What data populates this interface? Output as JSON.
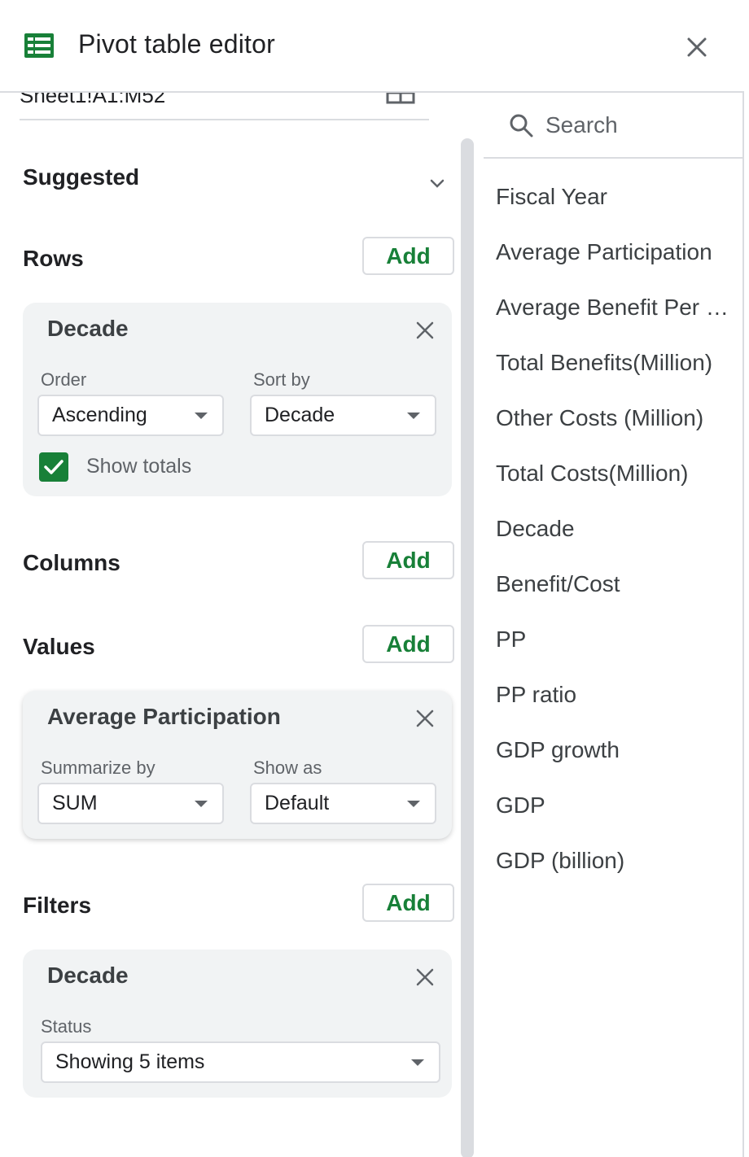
{
  "header": {
    "title": "Pivot table editor",
    "brand_color": "#188038"
  },
  "range": {
    "value": "Sheet1!A1:M52"
  },
  "sections": {
    "suggested": "Suggested",
    "rows": "Rows",
    "columns": "Columns",
    "values": "Values",
    "filters": "Filters",
    "add_label": "Add"
  },
  "rows_card": {
    "title": "Decade",
    "order_label": "Order",
    "order_value": "Ascending",
    "sort_label": "Sort by",
    "sort_value": "Decade",
    "show_totals_label": "Show totals",
    "show_totals_checked": true
  },
  "values_card": {
    "title": "Average Participation",
    "summarize_label": "Summarize by",
    "summarize_value": "SUM",
    "show_as_label": "Show as",
    "show_as_value": "Default"
  },
  "filters_card": {
    "title": "Decade",
    "status_label": "Status",
    "status_value": "Showing 5 items"
  },
  "search": {
    "placeholder": "Search"
  },
  "fields": [
    "Fiscal Year",
    "Average Participation",
    "Average Benefit Per …",
    "Total Benefits(Million)",
    "Other Costs (Million)",
    "Total Costs(Million)",
    "Decade",
    "Benefit/Cost",
    "PP",
    "PP ratio",
    "GDP growth",
    "GDP",
    "GDP (billion)"
  ]
}
